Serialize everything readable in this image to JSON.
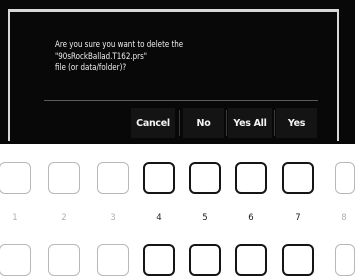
{
  "dialog": {
    "message": "Are you sure you want to delete the\n\"90sRockBallad.T162.prs\"\nfile (or data/folder)?",
    "buttons": {
      "cancel": "Cancel",
      "no": "No",
      "yes_all": "Yes All",
      "yes": "Yes"
    }
  },
  "button_panel": {
    "numbers": [
      "1",
      "2",
      "3",
      "4",
      "5",
      "6",
      "7",
      "8"
    ],
    "active_numbers": [
      "4",
      "5",
      "6",
      "7"
    ]
  }
}
